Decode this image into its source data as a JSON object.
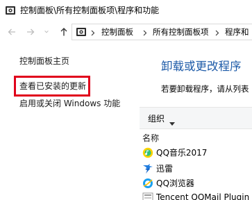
{
  "window": {
    "title": "控制面板\\所有控制面板项\\程序和功能"
  },
  "address": {
    "breadcrumbs": [
      "控制面板",
      "所有控制面板项",
      "程序和"
    ]
  },
  "sidebar": {
    "items": [
      {
        "label": "控制面板主页"
      },
      {
        "label": "查看已安装的更新"
      },
      {
        "label": "启用或关闭 Windows 功能"
      }
    ]
  },
  "main": {
    "title": "卸载或更改程序",
    "description": "若要卸载程序，请从列表"
  },
  "toolbar": {
    "organize_label": "组织"
  },
  "list": {
    "column_name": "名称",
    "programs": [
      {
        "name": "QQ音乐2017",
        "icon": "qq-music-icon"
      },
      {
        "name": "迅雷",
        "icon": "thunder-icon"
      },
      {
        "name": "QQ浏览器",
        "icon": "qq-browser-icon"
      },
      {
        "name": "Tencent QQMail Plugin",
        "icon": "qqmail-plugin-icon"
      }
    ]
  },
  "colors": {
    "accent_title": "#1e5ba8",
    "highlight": "#e0001b",
    "toolbar_bg": "#f5f6f7"
  }
}
